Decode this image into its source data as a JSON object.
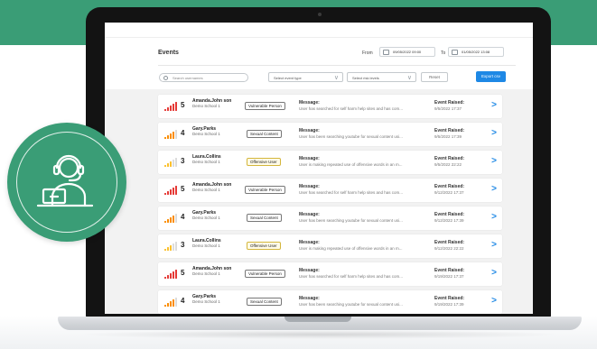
{
  "header": {
    "title": "Events",
    "from_label": "From",
    "from_value": "09/05/2022 09:00",
    "to_label": "To",
    "to_value": "01/05/2022 13:08"
  },
  "filters": {
    "search_placeholder": "Search usernames",
    "event_type_placeholder": "Select event type",
    "risk_level_placeholder": "Select risk levels",
    "reset_label": "Reset",
    "export_label": "Export csv"
  },
  "labels": {
    "message": "Message:",
    "event_raised": "Event Raised:"
  },
  "colors": {
    "brand_green": "#3a9d76",
    "accent_blue": "#1e88e5",
    "signal_red": "#e53935",
    "signal_orange": "#fb8c00",
    "signal_yellow": "#fbc02d"
  },
  "icons": {
    "badge": "support-agent-headset-laptop-icon",
    "calendar": "calendar-icon",
    "search": "search-icon",
    "dropdown": "chevron-down-icon",
    "row_action": "chevron-right-icon",
    "risk": "signal-bars-icon"
  },
  "events": [
    {
      "level": "5",
      "username": "Amanda.John son",
      "school": "Demo School 1",
      "type": "Vulnerable Person",
      "message": "User has searched for self harm help sites and has com...",
      "raised": "9/5/2022 17:37",
      "signal_color": "#e53935"
    },
    {
      "level": "4",
      "username": "Gary.Parks",
      "school": "Demo School 1",
      "type": "Sexual Content",
      "message": "User has been searching youtube for sexual content usi...",
      "raised": "9/5/2022 17:39",
      "signal_color": "#fb8c00"
    },
    {
      "level": "3",
      "username": "Laura.Collins",
      "school": "Demo School 1",
      "type": "Offensive User",
      "message": "User is making repeated use of offensive words in an m...",
      "raised": "9/5/2022 22:22",
      "signal_color": "#fbc02d"
    },
    {
      "level": "5",
      "username": "Amanda.John son",
      "school": "Demo School 1",
      "type": "Vulnerable Person",
      "message": "User has searched for self harm help sites and has com...",
      "raised": "9/12/2022 17:37",
      "signal_color": "#e53935"
    },
    {
      "level": "4",
      "username": "Gary.Parks",
      "school": "Demo School 1",
      "type": "Sexual Content",
      "message": "User has been searching youtube for sexual content usi...",
      "raised": "9/12/2022 17:39",
      "signal_color": "#fb8c00"
    },
    {
      "level": "3",
      "username": "Laura.Collins",
      "school": "Demo School 1",
      "type": "Offensive User",
      "message": "User is making repeated use of offensive words in an m...",
      "raised": "9/12/2022 22:22",
      "signal_color": "#fbc02d"
    },
    {
      "level": "5",
      "username": "Amanda.John son",
      "school": "Demo School 1",
      "type": "Vulnerable Person",
      "message": "User has searched for self harm help sites and has com...",
      "raised": "9/19/2022 17:37",
      "signal_color": "#e53935"
    },
    {
      "level": "4",
      "username": "Gary.Parks",
      "school": "Demo School 1",
      "type": "Sexual Content",
      "message": "User has been searching youtube for sexual content usi...",
      "raised": "9/19/2022 17:39",
      "signal_color": "#fb8c00"
    }
  ]
}
